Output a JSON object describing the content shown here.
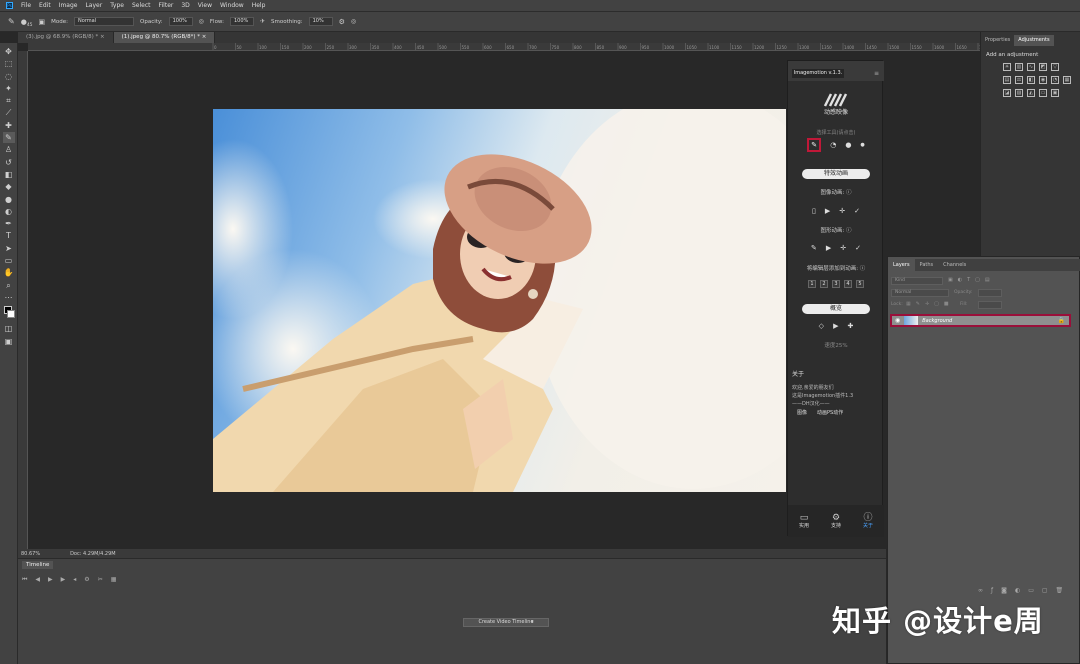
{
  "menu": {
    "app_icon": "Ps",
    "items": [
      "File",
      "Edit",
      "Image",
      "Layer",
      "Type",
      "Select",
      "Filter",
      "3D",
      "View",
      "Window",
      "Help"
    ]
  },
  "options": {
    "brush_size": "45",
    "mode_label": "Mode:",
    "mode_value": "Normal",
    "opacity_label": "Opacity:",
    "opacity_value": "100%",
    "flow_label": "Flow:",
    "flow_value": "100%",
    "smoothing_label": "Smoothing:",
    "smoothing_value": "10%"
  },
  "tabs": [
    {
      "label": "(3).jpg @ 68.9% (RGB/8) *"
    },
    {
      "label": "(1).jpeg @ 80.7% (RGB/8*) *"
    }
  ],
  "ruler_ticks": [
    "0",
    "50",
    "100",
    "150",
    "200",
    "250",
    "300",
    "350",
    "400",
    "450",
    "500",
    "550",
    "600",
    "650",
    "700",
    "750",
    "800",
    "850",
    "900",
    "950",
    "1000",
    "1050",
    "1100",
    "1150",
    "1200",
    "1250",
    "1300",
    "1350",
    "1400",
    "1450",
    "1500",
    "1550",
    "1600",
    "1650",
    "1700",
    "1750",
    "1800",
    "1850",
    "1900"
  ],
  "status": {
    "zoom": "80.67%",
    "doc": "Doc: 4.29M/4.29M"
  },
  "timeline": {
    "tab": "Timeline",
    "create_button": "Create Video Timeline"
  },
  "plugin": {
    "title": "Imagemotion v.1.3.",
    "brand": "动感映像",
    "tool_hint": "选择工具(请点击)",
    "effects_button": "特效动画",
    "image_anim_label": "图像动画:",
    "shape_anim_label": "图形动画:",
    "add_anim_label": "将编辑层添加到动画:",
    "numbers": [
      "1",
      "2",
      "3",
      "4",
      "5"
    ],
    "preview_button": "概览",
    "speed_label": "速度25%",
    "about_title": "关于",
    "about_lines": [
      "欢迎,亲爱的朋友们",
      "这是Imagemotion插件1.3",
      "——DH汉化——"
    ],
    "about_links": [
      "图像",
      "动画PS动作"
    ],
    "footer": [
      {
        "label": "实用",
        "icon": "monitor-icon"
      },
      {
        "label": "支持",
        "icon": "gear-icon"
      },
      {
        "label": "关于",
        "icon": "help-icon"
      }
    ]
  },
  "right_panel": {
    "tabs": [
      "Properties",
      "Adjustments"
    ],
    "adjust_title": "Add an adjustment"
  },
  "layers": {
    "tabs": [
      "Layers",
      "Paths",
      "Channels"
    ],
    "kind_placeholder": "Kind",
    "blend_mode": "Normal",
    "opacity_label": "Opacity:",
    "lock_label": "Lock:",
    "fill_label": "Fill:",
    "layer_name": "Background"
  },
  "watermark": "知乎 @设计e周"
}
